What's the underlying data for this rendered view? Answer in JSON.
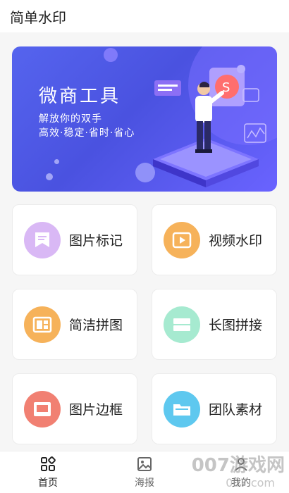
{
  "header": {
    "title": "简单水印"
  },
  "banner": {
    "title": "微商工具",
    "subtitle_line1": "解放你的双手",
    "subtitle_line2": "高效·稳定·省时·省心"
  },
  "tools": [
    {
      "label": "图片标记",
      "icon": "picture-mark-icon",
      "color": "#d9b8f5"
    },
    {
      "label": "视频水印",
      "icon": "video-play-icon",
      "color": "#f6b25a"
    },
    {
      "label": "简洁拼图",
      "icon": "collage-icon",
      "color": "#f6b25a"
    },
    {
      "label": "长图拼接",
      "icon": "long-image-icon",
      "color": "#a6ead0"
    },
    {
      "label": "图片边框",
      "icon": "picture-frame-icon",
      "color": "#f18072"
    },
    {
      "label": "团队素材",
      "icon": "folder-icon",
      "color": "#5ec8ef"
    }
  ],
  "tabbar": {
    "home": "首页",
    "poster": "海报",
    "mine": "我的"
  },
  "watermark": {
    "text": "007游戏网",
    "sub": "007.com"
  }
}
